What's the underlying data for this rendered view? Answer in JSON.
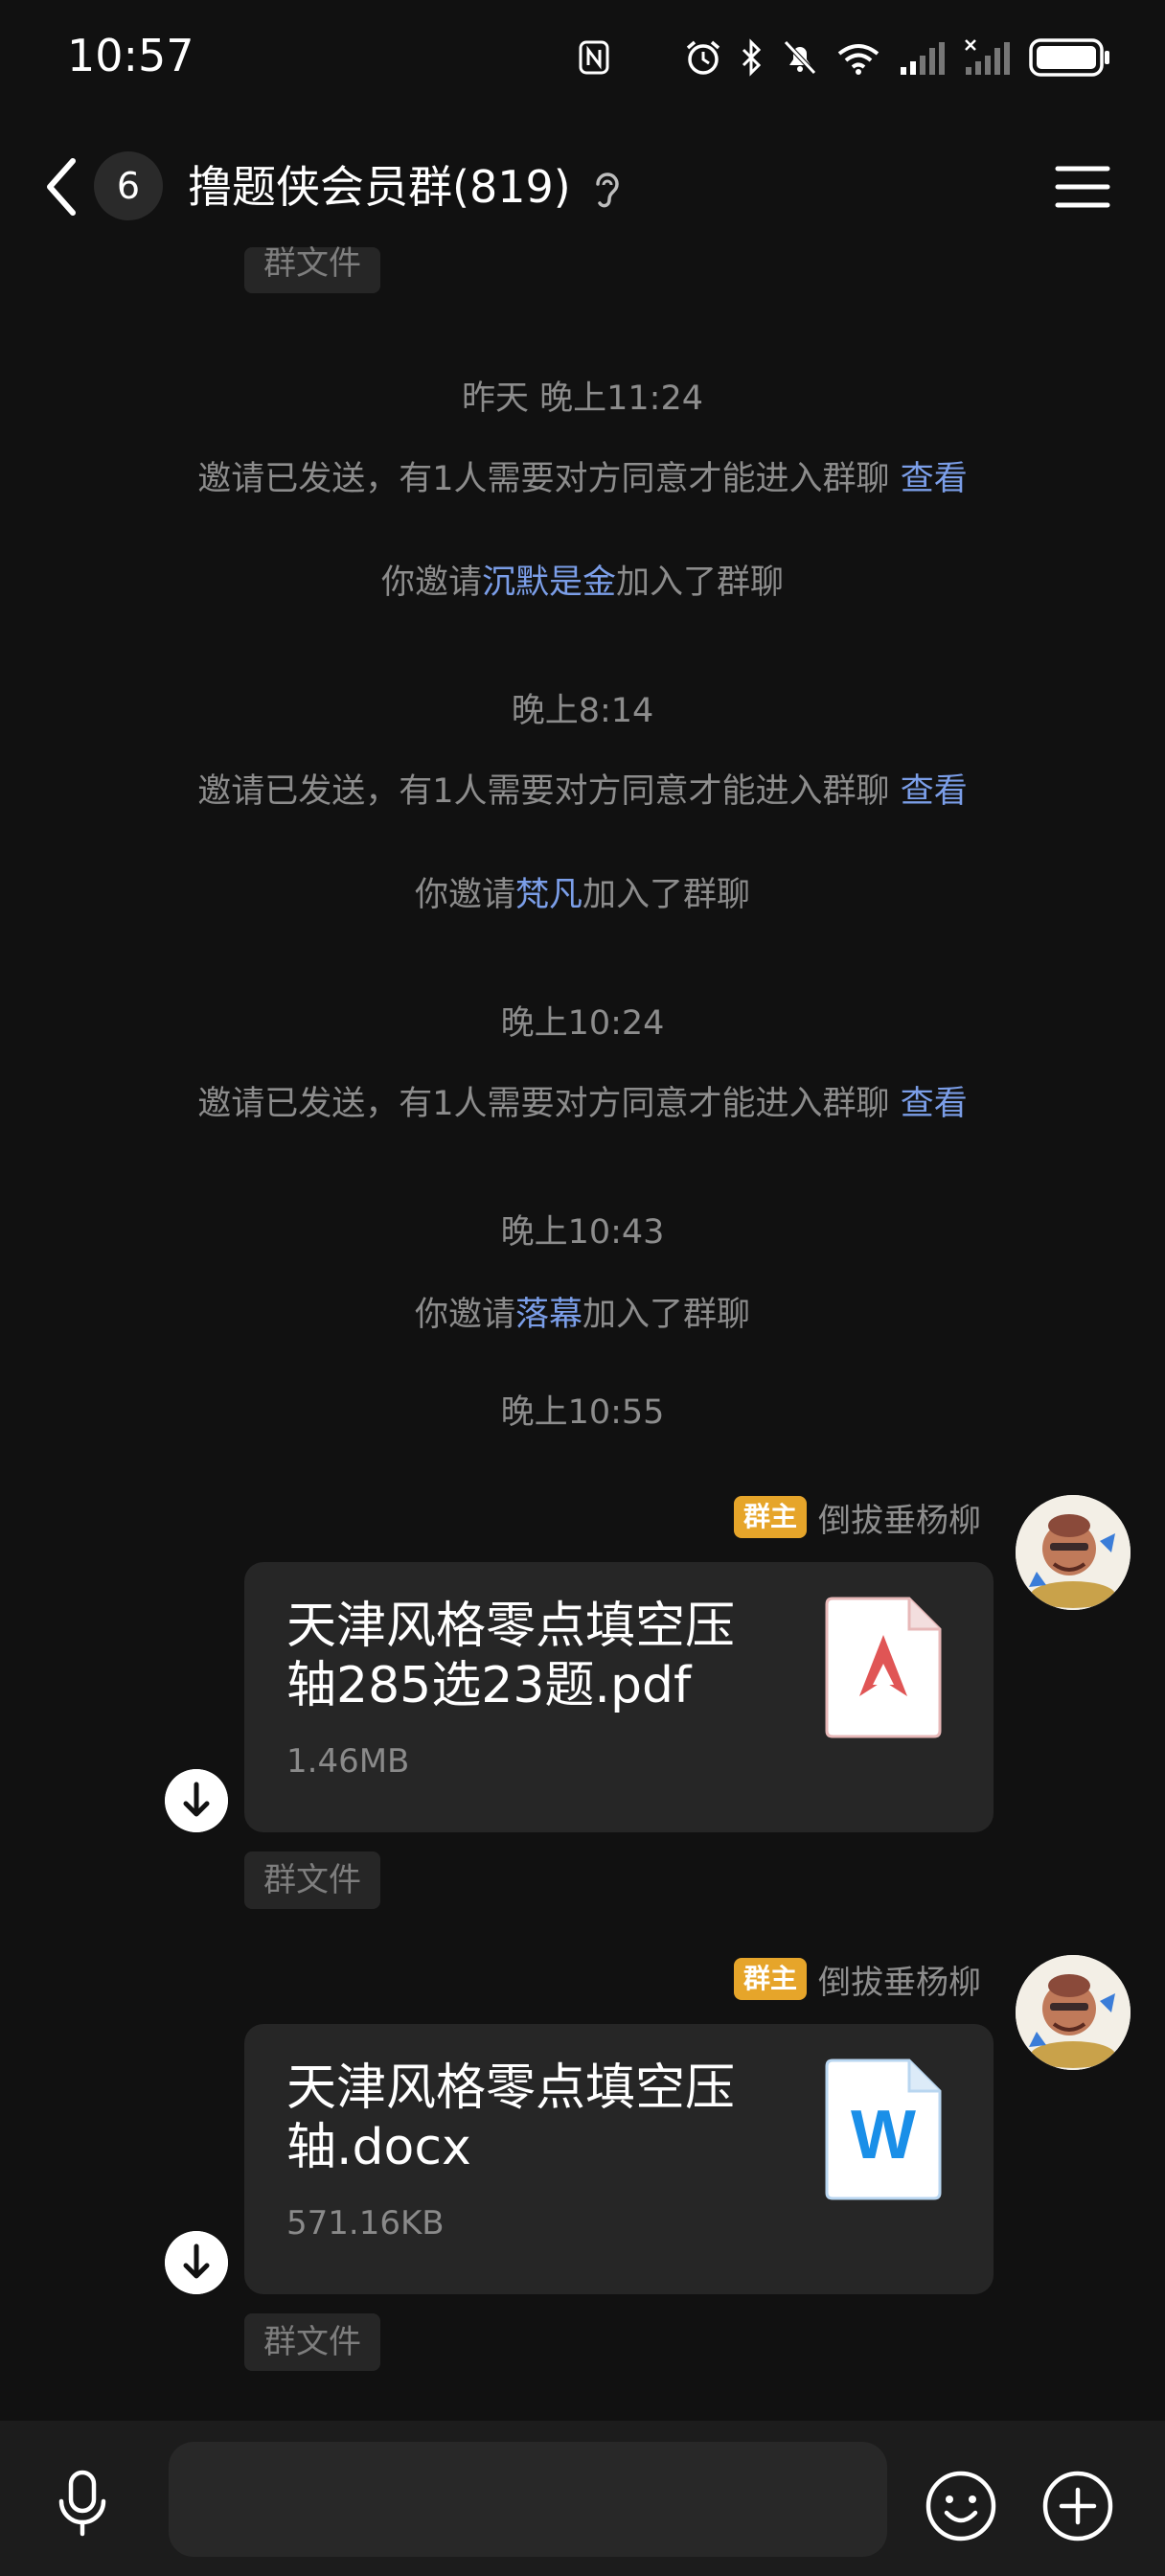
{
  "status_bar": {
    "time": "10:57"
  },
  "header": {
    "unread_count": "6",
    "title": "撸题侠会员群(819)"
  },
  "top_partial_tag": "群文件",
  "system_messages": [
    {
      "time": "昨天 晚上11:24"
    },
    {
      "text": "邀请已发送，有1人需要对方同意才能进入群聊",
      "link": "查看"
    },
    {
      "prefix": "你邀请",
      "name": "沉默是金",
      "suffix": "加入了群聊"
    },
    {
      "time": "晚上8:14"
    },
    {
      "text": "邀请已发送，有1人需要对方同意才能进入群聊",
      "link": "查看"
    },
    {
      "prefix": "你邀请",
      "name": "梵凡",
      "suffix": "加入了群聊"
    },
    {
      "time": "晚上10:24"
    },
    {
      "text": "邀请已发送，有1人需要对方同意才能进入群聊",
      "link": "查看"
    },
    {
      "time": "晚上10:43"
    },
    {
      "prefix": "你邀请",
      "name": "落幕",
      "suffix": "加入了群聊"
    },
    {
      "time": "晚上10:55"
    }
  ],
  "messages": [
    {
      "role_badge": "群主",
      "sender": "倒拔垂杨柳",
      "file_name": "天津风格零点填空压轴285选23题.pdf",
      "file_size": "1.46MB",
      "file_type": "pdf-icon",
      "tag": "群文件"
    },
    {
      "role_badge": "群主",
      "sender": "倒拔垂杨柳",
      "file_name": "天津风格零点填空压轴.docx",
      "file_size": "571.16KB",
      "file_type": "word-icon",
      "word_letter": "W",
      "tag": "群文件"
    }
  ],
  "colors": {
    "background": "#111111",
    "link": "#7b9ee8",
    "badge": "#e6a52a",
    "pdf": "#e05555",
    "word": "#1a8fe8"
  }
}
